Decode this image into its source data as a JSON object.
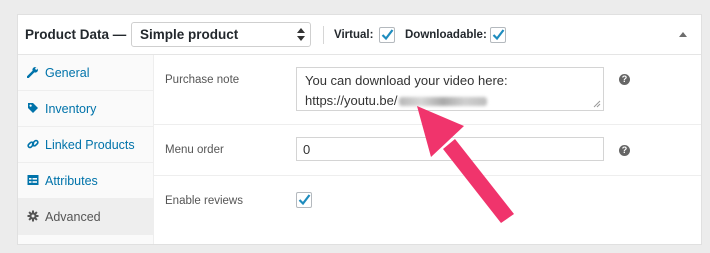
{
  "header": {
    "title": "Product Data —",
    "product_type": "Simple product",
    "virtual_label": "Virtual:",
    "virtual_checked": true,
    "downloadable_label": "Downloadable:",
    "downloadable_checked": true
  },
  "tabs": [
    {
      "label": "General",
      "icon": "wrench-icon",
      "active": false
    },
    {
      "label": "Inventory",
      "icon": "tag-icon",
      "active": false
    },
    {
      "label": "Linked Products",
      "icon": "link-icon",
      "active": false
    },
    {
      "label": "Attributes",
      "icon": "table-icon",
      "active": false
    },
    {
      "label": "Advanced",
      "icon": "gear-icon",
      "active": true
    }
  ],
  "fields": {
    "purchase_note": {
      "label": "Purchase note",
      "line1": "You can download your video here:",
      "line2": "https://youtu.be/"
    },
    "menu_order": {
      "label": "Menu order",
      "value": "0"
    },
    "enable_reviews": {
      "label": "Enable reviews",
      "checked": true
    }
  },
  "colors": {
    "link": "#0073aa",
    "check": "#1e8cbe",
    "annotation_arrow": "#f0346c"
  }
}
